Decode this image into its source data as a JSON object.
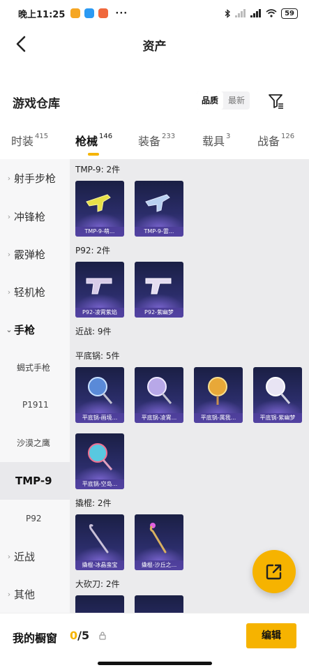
{
  "status": {
    "time": "晚上11:25",
    "more": "···",
    "battery": "59"
  },
  "header": {
    "title": "资产"
  },
  "section": {
    "title": "游戏仓库",
    "sort_quality": "品质",
    "sort_newest": "最新"
  },
  "tabs": [
    {
      "label": "时装",
      "count": "415"
    },
    {
      "label": "枪械",
      "count": "146"
    },
    {
      "label": "装备",
      "count": "233"
    },
    {
      "label": "载具",
      "count": "3"
    },
    {
      "label": "战备",
      "count": "126"
    }
  ],
  "sidebar": [
    {
      "label": "射手步枪"
    },
    {
      "label": "冲锋枪"
    },
    {
      "label": "霰弹枪"
    },
    {
      "label": "轻机枪"
    },
    {
      "label": "手枪"
    },
    {
      "label": "蝎式手枪"
    },
    {
      "label": "P1911"
    },
    {
      "label": "沙漠之鹰"
    },
    {
      "label": "TMP-9"
    },
    {
      "label": "P92"
    },
    {
      "label": "近战"
    },
    {
      "label": "其他"
    }
  ],
  "groups": {
    "tmp9": {
      "label": "TMP-9: 2件",
      "items": [
        {
          "name": "TMP-9-萌..."
        },
        {
          "name": "TMP-9-雷..."
        }
      ]
    },
    "p92": {
      "label": "P92: 2件",
      "items": [
        {
          "name": "P92-凌霄紫焰"
        },
        {
          "name": "P92-紫幽梦"
        }
      ]
    },
    "melee": {
      "label": "近战: 9件"
    },
    "pan": {
      "label": "平底锅: 5件",
      "items": [
        {
          "name": "平底锅-画境..."
        },
        {
          "name": "平底锅-凌霄..."
        },
        {
          "name": "平底锅-属我..."
        },
        {
          "name": "平底锅-紫幽梦"
        },
        {
          "name": "平底锅-空岛..."
        }
      ]
    },
    "crowbar": {
      "label": "撬棍: 2件",
      "items": [
        {
          "name": "撬棍-冰晶蛮宝"
        },
        {
          "name": "撬棍-沙丘之..."
        }
      ]
    },
    "machete": {
      "label": "大砍刀: 2件"
    }
  },
  "bottom": {
    "showcase_label": "我的橱窗",
    "showcase_current": "0",
    "showcase_total": "/5",
    "edit_label": "编辑"
  },
  "colors": {
    "accent": "#f6b300",
    "card_bg": "#2b2d6a"
  }
}
